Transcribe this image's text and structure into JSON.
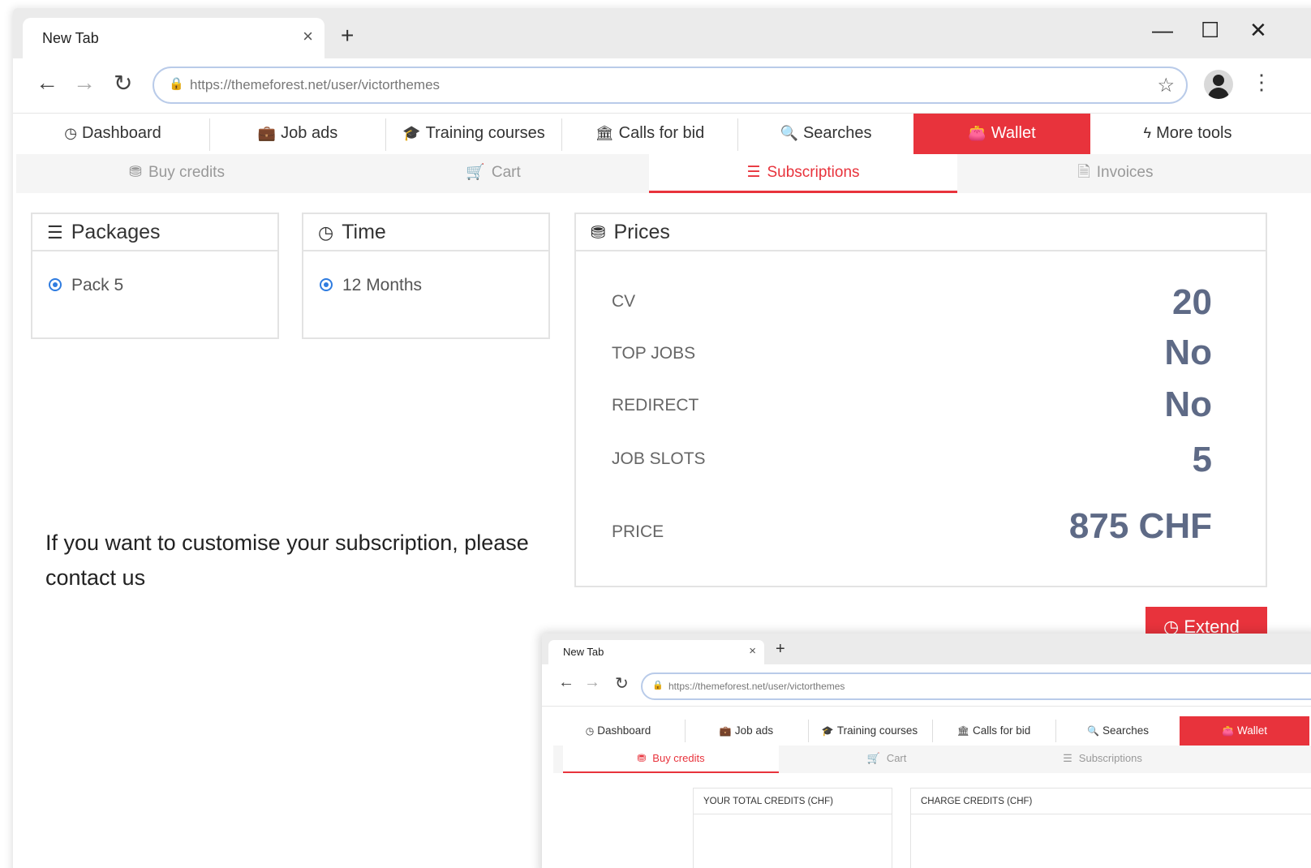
{
  "browser": {
    "tab_title": "New Tab",
    "tab_close": "×",
    "new_tab": "+",
    "url": "https://themeforest.net/user/victorthemes",
    "controls": {
      "minimize": "—",
      "maximize": "☐",
      "close": "✕"
    },
    "nav": {
      "back": "←",
      "forward": "→",
      "reload": "↻",
      "lock": "🔒",
      "star": "☆",
      "menu": "⋮"
    }
  },
  "topnav": {
    "items": [
      {
        "label": "Dashboard",
        "icon": "◷"
      },
      {
        "label": "Job ads",
        "icon": "💼"
      },
      {
        "label": "Training courses",
        "icon": "🎓"
      },
      {
        "label": "Calls for bid",
        "icon": "🏛"
      },
      {
        "label": "Searches",
        "icon": "🔍"
      },
      {
        "label": "Wallet",
        "icon": "👛"
      },
      {
        "label": "More tools",
        "icon": "ϟ"
      }
    ]
  },
  "subnav": {
    "items": [
      {
        "label": "Buy credits",
        "icon": "⛃"
      },
      {
        "label": "Cart",
        "icon": "🛒"
      },
      {
        "label": "Subscriptions",
        "icon": "☰"
      },
      {
        "label": "Invoices",
        "icon": "🗎"
      }
    ]
  },
  "packages": {
    "title": "Packages",
    "icon": "☰",
    "option": "Pack 5"
  },
  "time": {
    "title": "Time",
    "icon": "◷",
    "option": "12 Months"
  },
  "prices": {
    "title": "Prices",
    "icon": "⛃",
    "rows": [
      {
        "label": "CV",
        "value": "20"
      },
      {
        "label": "TOP JOBS",
        "value": "No"
      },
      {
        "label": "REDIRECT",
        "value": "No"
      },
      {
        "label": "JOB SLOTS",
        "value": "5"
      },
      {
        "label": "PRICE",
        "value": "875 CHF"
      }
    ]
  },
  "custom_message": "If you want to customise your subscription, please contact us",
  "extend_button": {
    "label": "Extend",
    "icon": "◷"
  },
  "inner": {
    "tab_title": "New Tab",
    "tab_close": "×",
    "new_tab": "+",
    "url": "https://themeforest.net/user/victorthemes",
    "nav": {
      "back": "←",
      "forward": "→",
      "reload": "↻",
      "lock": "🔒"
    },
    "topnav": [
      {
        "label": "Dashboard",
        "icon": "◷"
      },
      {
        "label": "Job ads",
        "icon": "💼"
      },
      {
        "label": "Training courses",
        "icon": "🎓"
      },
      {
        "label": "Calls for bid",
        "icon": "🏛"
      },
      {
        "label": "Searches",
        "icon": "🔍"
      },
      {
        "label": "Wallet",
        "icon": "👛"
      }
    ],
    "subnav": [
      {
        "label": "Buy credits",
        "icon": "⛃"
      },
      {
        "label": "Cart",
        "icon": "🛒"
      },
      {
        "label": "Subscriptions",
        "icon": "☰"
      }
    ],
    "total_credits_label": "YOUR TOTAL CREDITS (CHF)",
    "charge_credits_label": "CHARGE CREDITS (CHF)"
  },
  "colors": {
    "accent": "#e8333c",
    "value_text": "#5e6a86",
    "radio": "#2f7ce0"
  }
}
